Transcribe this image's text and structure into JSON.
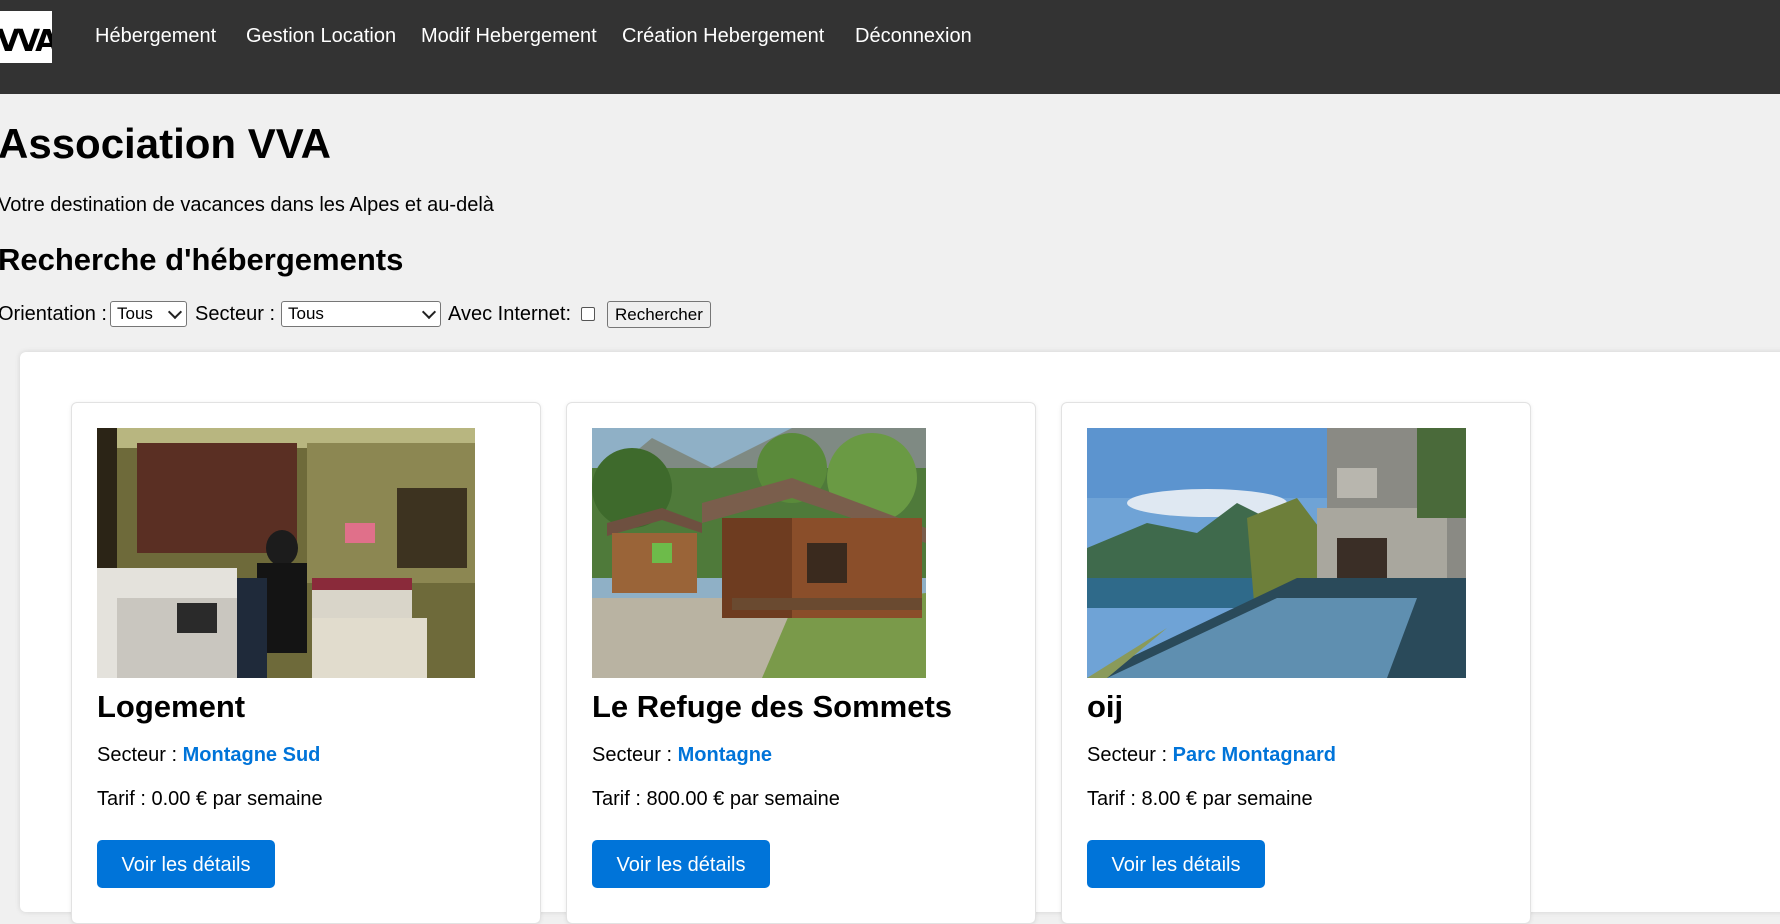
{
  "nav": {
    "logo_text": "VVA",
    "links": [
      "Hébergement",
      "Gestion Location",
      "Modif Hebergement",
      "Création Hebergement",
      "Déconnexion"
    ]
  },
  "header": {
    "title": "Association VVA",
    "tagline": "Votre destination de vacances dans les Alpes et au-delà"
  },
  "search": {
    "title": "Recherche d'hébergements",
    "orientation_label": "Orientation :",
    "orientation_value": "Tous",
    "secteur_label": "Secteur :",
    "secteur_value": "Tous",
    "internet_label": "Avec Internet:",
    "internet_checked": false,
    "submit_label": "Rechercher"
  },
  "cards": [
    {
      "title": "Logement",
      "sector_label": "Secteur :",
      "sector": "Montagne Sud",
      "price_text": "Tarif : 0.00 € par semaine",
      "button": "Voir les détails",
      "image": "dorm-room-photo"
    },
    {
      "title": "Le Refuge des Sommets",
      "sector_label": "Secteur :",
      "sector": "Montagne",
      "price_text": "Tarif : 800.00 € par semaine",
      "button": "Voir les détails",
      "image": "wooden-chalet-photo"
    },
    {
      "title": "oij",
      "sector_label": "Secteur :",
      "sector": "Parc Montagnard",
      "price_text": "Tarif : 8.00 € par semaine",
      "button": "Voir les détails",
      "image": "infinity-pool-lake-photo"
    }
  ],
  "colors": {
    "nav_bg": "#333333",
    "page_bg": "#f0f0f0",
    "accent": "#0074d9"
  }
}
